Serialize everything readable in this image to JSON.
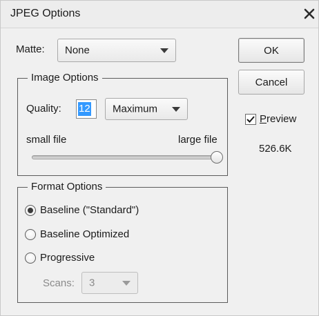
{
  "window": {
    "title": "JPEG Options",
    "close_icon": "close-x-icon"
  },
  "matte": {
    "label": "Matte:",
    "value": "None"
  },
  "image_options": {
    "title": "Image Options",
    "quality_label": "Quality:",
    "quality_value": "12",
    "quality_preset": "Maximum",
    "small_file_label": "small file",
    "large_file_label": "large file",
    "slider_value": 1.0
  },
  "format_options": {
    "title": "Format Options",
    "options": [
      {
        "label": "Baseline (\"Standard\")",
        "selected": true
      },
      {
        "label": "Baseline Optimized",
        "selected": false
      },
      {
        "label": "Progressive",
        "selected": false
      }
    ],
    "scans_label": "Scans:",
    "scans_value": "3"
  },
  "buttons": {
    "ok": "OK",
    "cancel": "Cancel"
  },
  "preview": {
    "first_letter": "P",
    "rest": "review",
    "checked": true,
    "file_size": "526.6K"
  },
  "colors": {
    "dialog_bg": "#f0f0f0",
    "selection": "#3399ff",
    "border": "#5a5a5a"
  }
}
